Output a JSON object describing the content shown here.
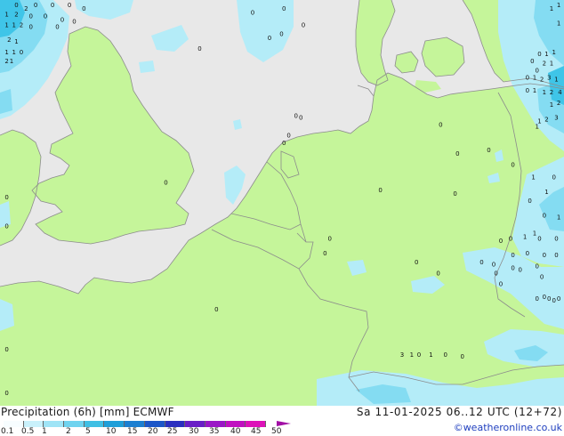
{
  "title": "Precipitation (6h) [mm] ECMWF",
  "datetime": "Sa 11-01-2025 06..12 UTC (12+72)",
  "credit": "©weatheronline.co.uk",
  "colors": {
    "sea": "#e8e8e8",
    "land": "#c5f59a",
    "border": "#8c8c8c",
    "precip_light": "#b4ecf8",
    "precip_mid": "#84dcf2",
    "precip_heavy": "#3fc5e8"
  },
  "legend": {
    "ticks": [
      "0.1",
      "0.5",
      "1",
      "2",
      "5",
      "10",
      "15",
      "20",
      "25",
      "30",
      "35",
      "40",
      "45",
      "50"
    ],
    "swatch_colors": [
      "#f7fdff",
      "#c9f1fb",
      "#9fe4f6",
      "#6fd3ef",
      "#3fbfe4",
      "#1f9fd9",
      "#1c7fd1",
      "#1c56c8",
      "#2a2fbf",
      "#6a1ec6",
      "#9a16c6",
      "#c010c0",
      "#dd12b8",
      "#a20fa6"
    ]
  },
  "point_values": [
    {
      "label": "0",
      "lon": -9.6,
      "lat": 58.4
    },
    {
      "label": "2",
      "lon": -9.2,
      "lat": 58.3
    },
    {
      "label": "0",
      "lon": -8.8,
      "lat": 58.4
    },
    {
      "label": "0",
      "lon": -8.1,
      "lat": 58.4
    },
    {
      "label": "0",
      "lon": -7.4,
      "lat": 58.4
    },
    {
      "label": "0",
      "lon": -6.8,
      "lat": 58.3
    },
    {
      "label": "1",
      "lon": -10.0,
      "lat": 58.15
    },
    {
      "label": "2",
      "lon": -9.6,
      "lat": 58.15
    },
    {
      "label": "0",
      "lon": -9.0,
      "lat": 58.1
    },
    {
      "label": "0",
      "lon": -8.4,
      "lat": 58.1
    },
    {
      "label": "1",
      "lon": -10.0,
      "lat": 57.85
    },
    {
      "label": "1",
      "lon": -9.7,
      "lat": 57.85
    },
    {
      "label": "2",
      "lon": -9.4,
      "lat": 57.85
    },
    {
      "label": "0",
      "lon": -9.0,
      "lat": 57.8
    },
    {
      "label": "0",
      "lon": -7.9,
      "lat": 57.8
    },
    {
      "label": "2",
      "lon": -9.9,
      "lat": 57.45
    },
    {
      "label": "1",
      "lon": -9.6,
      "lat": 57.4
    },
    {
      "label": "1",
      "lon": -10.0,
      "lat": 57.1
    },
    {
      "label": "1",
      "lon": -9.7,
      "lat": 57.1
    },
    {
      "label": "0",
      "lon": -9.4,
      "lat": 57.1
    },
    {
      "label": "2",
      "lon": -10.0,
      "lat": 56.85
    },
    {
      "label": "1",
      "lon": -9.8,
      "lat": 56.85
    },
    {
      "label": "0",
      "lon": -7.7,
      "lat": 58.0
    },
    {
      "label": "0",
      "lon": -7.2,
      "lat": 57.95
    },
    {
      "label": "0",
      "lon": 0.2,
      "lat": 58.2
    },
    {
      "label": "0",
      "lon": 1.5,
      "lat": 58.3
    },
    {
      "label": "0",
      "lon": 2.3,
      "lat": 57.85
    },
    {
      "label": "0",
      "lon": 1.4,
      "lat": 57.6
    },
    {
      "label": "0",
      "lon": 0.9,
      "lat": 57.5
    },
    {
      "label": "0",
      "lon": -2.0,
      "lat": 57.2
    },
    {
      "label": "0",
      "lon": 2.0,
      "lat": 55.35
    },
    {
      "label": "0",
      "lon": 2.2,
      "lat": 55.3
    },
    {
      "label": "0",
      "lon": 1.7,
      "lat": 54.8
    },
    {
      "label": "0",
      "lon": 1.5,
      "lat": 54.6
    },
    {
      "label": "0",
      "lon": -3.4,
      "lat": 53.5
    },
    {
      "label": "0",
      "lon": -10.0,
      "lat": 53.1
    },
    {
      "label": "0",
      "lon": -10.0,
      "lat": 52.3
    },
    {
      "label": "0",
      "lon": 8.0,
      "lat": 55.1
    },
    {
      "label": "0",
      "lon": 8.7,
      "lat": 54.3
    },
    {
      "label": "0",
      "lon": 10.0,
      "lat": 54.4
    },
    {
      "label": "0",
      "lon": 11.0,
      "lat": 54.0
    },
    {
      "label": "1",
      "lon": 12.1,
      "lat": 55.2
    },
    {
      "label": "2",
      "lon": 12.4,
      "lat": 55.25
    },
    {
      "label": "3",
      "lon": 12.8,
      "lat": 55.3
    },
    {
      "label": "1",
      "lon": 12.0,
      "lat": 55.05
    },
    {
      "label": "1",
      "lon": 12.6,
      "lat": 55.65
    },
    {
      "label": "2",
      "lon": 12.9,
      "lat": 55.7
    },
    {
      "label": "0",
      "lon": 11.6,
      "lat": 56.05
    },
    {
      "label": "1",
      "lon": 11.9,
      "lat": 56.05
    },
    {
      "label": "1",
      "lon": 12.3,
      "lat": 56.0
    },
    {
      "label": "2",
      "lon": 12.6,
      "lat": 56.0
    },
    {
      "label": "4",
      "lon": 12.95,
      "lat": 56.0
    },
    {
      "label": "0",
      "lon": 11.6,
      "lat": 56.4
    },
    {
      "label": "1",
      "lon": 11.9,
      "lat": 56.4
    },
    {
      "label": "2",
      "lon": 12.2,
      "lat": 56.35
    },
    {
      "label": "3",
      "lon": 12.5,
      "lat": 56.4
    },
    {
      "label": "1",
      "lon": 12.8,
      "lat": 56.35
    },
    {
      "label": "2",
      "lon": 12.3,
      "lat": 56.8
    },
    {
      "label": "1",
      "lon": 12.6,
      "lat": 56.8
    },
    {
      "label": "0",
      "lon": 12.0,
      "lat": 56.6
    },
    {
      "label": "0",
      "lon": 12.1,
      "lat": 57.05
    },
    {
      "label": "1",
      "lon": 12.4,
      "lat": 57.05
    },
    {
      "label": "1",
      "lon": 12.7,
      "lat": 57.1
    },
    {
      "label": "1",
      "lon": 12.9,
      "lat": 57.9
    },
    {
      "label": "1",
      "lon": 12.6,
      "lat": 58.3
    },
    {
      "label": "1",
      "lon": 12.9,
      "lat": 58.4
    },
    {
      "label": "0",
      "lon": 11.8,
      "lat": 56.85
    },
    {
      "label": "0",
      "lon": 3.4,
      "lat": 51.95
    },
    {
      "label": "0",
      "lon": 3.2,
      "lat": 51.55
    },
    {
      "label": "0",
      "lon": -1.3,
      "lat": 50.0
    },
    {
      "label": "0",
      "lon": -10.0,
      "lat": 48.9
    },
    {
      "label": "0",
      "lon": -10.0,
      "lat": 47.7
    },
    {
      "label": "0",
      "lon": 5.5,
      "lat": 53.3
    },
    {
      "label": "0",
      "lon": 8.6,
      "lat": 53.2
    },
    {
      "label": "0",
      "lon": 11.7,
      "lat": 53.0
    },
    {
      "label": "1",
      "lon": 11.85,
      "lat": 53.65
    },
    {
      "label": "0",
      "lon": 12.3,
      "lat": 52.6
    },
    {
      "label": "1",
      "lon": 12.4,
      "lat": 53.25
    },
    {
      "label": "0",
      "lon": 12.7,
      "lat": 53.65
    },
    {
      "label": "1",
      "lon": 12.9,
      "lat": 52.55
    },
    {
      "label": "1",
      "lon": 11.9,
      "lat": 52.1
    },
    {
      "label": "1",
      "lon": 11.5,
      "lat": 52.0
    },
    {
      "label": "0",
      "lon": 10.9,
      "lat": 51.95
    },
    {
      "label": "0",
      "lon": 10.5,
      "lat": 51.9
    },
    {
      "label": "0",
      "lon": 12.1,
      "lat": 51.95
    },
    {
      "label": "0",
      "lon": 12.8,
      "lat": 51.95
    },
    {
      "label": "0",
      "lon": 11.0,
      "lat": 51.5
    },
    {
      "label": "0",
      "lon": 11.6,
      "lat": 51.55
    },
    {
      "label": "0",
      "lon": 12.3,
      "lat": 51.5
    },
    {
      "label": "0",
      "lon": 12.8,
      "lat": 51.5
    },
    {
      "label": "0",
      "lon": 11.3,
      "lat": 51.1
    },
    {
      "label": "0",
      "lon": 9.7,
      "lat": 51.3
    },
    {
      "label": "0",
      "lon": 10.2,
      "lat": 51.25
    },
    {
      "label": "0",
      "lon": 11.0,
      "lat": 51.15
    },
    {
      "label": "0",
      "lon": 12.0,
      "lat": 51.2
    },
    {
      "label": "0",
      "lon": 10.5,
      "lat": 50.7
    },
    {
      "label": "0",
      "lon": 12.2,
      "lat": 50.9
    },
    {
      "label": "0",
      "lon": 7.0,
      "lat": 51.3
    },
    {
      "label": "0",
      "lon": 7.9,
      "lat": 51.0
    },
    {
      "label": "0",
      "lon": 10.3,
      "lat": 51.0
    },
    {
      "label": "0",
      "lon": 12.0,
      "lat": 50.3
    },
    {
      "label": "0",
      "lon": 12.3,
      "lat": 50.35
    },
    {
      "label": "0",
      "lon": 12.5,
      "lat": 50.3
    },
    {
      "label": "0",
      "lon": 12.7,
      "lat": 50.25
    },
    {
      "label": "0",
      "lon": 12.9,
      "lat": 50.3
    },
    {
      "label": "3",
      "lon": 6.4,
      "lat": 48.75
    },
    {
      "label": "1",
      "lon": 6.8,
      "lat": 48.75
    },
    {
      "label": "0",
      "lon": 7.1,
      "lat": 48.75
    },
    {
      "label": "1",
      "lon": 7.6,
      "lat": 48.75
    },
    {
      "label": "0",
      "lon": 8.2,
      "lat": 48.75
    },
    {
      "label": "0",
      "lon": 8.9,
      "lat": 48.7
    }
  ]
}
